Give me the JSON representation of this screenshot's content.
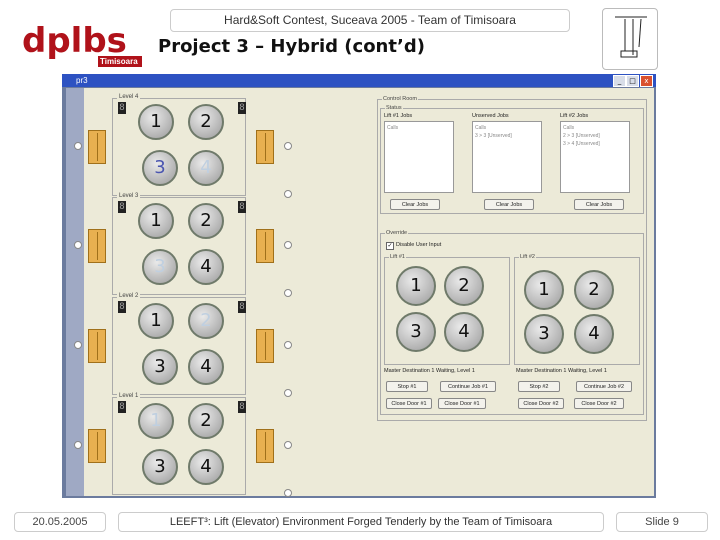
{
  "header": {
    "banner": "Hard&Soft Contest, Suceava 2005  -  Team of Timisoara",
    "title": "Project 3 – Hybrid (cont’d)",
    "logo_text": "Timisoara"
  },
  "window": {
    "title": "pr3",
    "buttons": [
      "_",
      "□",
      "x"
    ]
  },
  "floors": [
    {
      "label": "Level 4",
      "display": "8",
      "buttons": [
        "1",
        "2",
        "3",
        "4"
      ],
      "states": [
        "normal",
        "normal",
        "lit",
        "pale"
      ]
    },
    {
      "label": "Level 3",
      "display": "8",
      "buttons": [
        "1",
        "2",
        "3",
        "4"
      ],
      "states": [
        "normal",
        "normal",
        "pale",
        "normal"
      ]
    },
    {
      "label": "Level 2",
      "display": "8",
      "buttons": [
        "1",
        "2",
        "3",
        "4"
      ],
      "states": [
        "normal",
        "pale",
        "normal",
        "normal"
      ]
    },
    {
      "label": "Level 1",
      "display": "8",
      "buttons": [
        "1",
        "2",
        "3",
        "4"
      ],
      "states": [
        "pale",
        "normal",
        "normal",
        "normal"
      ]
    }
  ],
  "control": {
    "title": "Control Room",
    "status_label": "Status",
    "jobs": [
      {
        "header": "Lift #1 Jobs",
        "items": [
          "Calls"
        ]
      },
      {
        "header": "Unserved Jobs",
        "items": [
          "Calls",
          "3 > 3 [Unserved]"
        ]
      },
      {
        "header": "Lift #2 Jobs",
        "items": [
          "Calls",
          "2 > 3 [Unserved]",
          "3 > 4 [Unserved]"
        ]
      }
    ],
    "clear_buttons": [
      "Clear Jobs",
      "Clear Jobs",
      "Clear Jobs"
    ],
    "override_label": "Override",
    "disable_user_input": "Disable User Input",
    "lift1_label": "Lift #1",
    "lift2_label": "Lift #2",
    "lift1_buttons": [
      "1",
      "2",
      "3",
      "4"
    ],
    "lift2_buttons": [
      "1",
      "2",
      "3",
      "4"
    ],
    "lift1_status": "Master Destination 1   Waiting, Level 1",
    "lift2_status": "Master Destination 1   Waiting, Level 1",
    "lift1_actions": [
      "Stop #1",
      "Continue Job #1",
      "Close Door #1",
      "Close Door #1"
    ],
    "lift2_actions": [
      "Stop #2",
      "Continue Job #2",
      "Close Door #2",
      "Close Door #2"
    ]
  },
  "footer": {
    "date": "20.05.2005",
    "text": "LEEFT³: Lift (Elevator) Environment Forged Tenderly by the Team of Timisoara",
    "slide": "Slide  9"
  }
}
